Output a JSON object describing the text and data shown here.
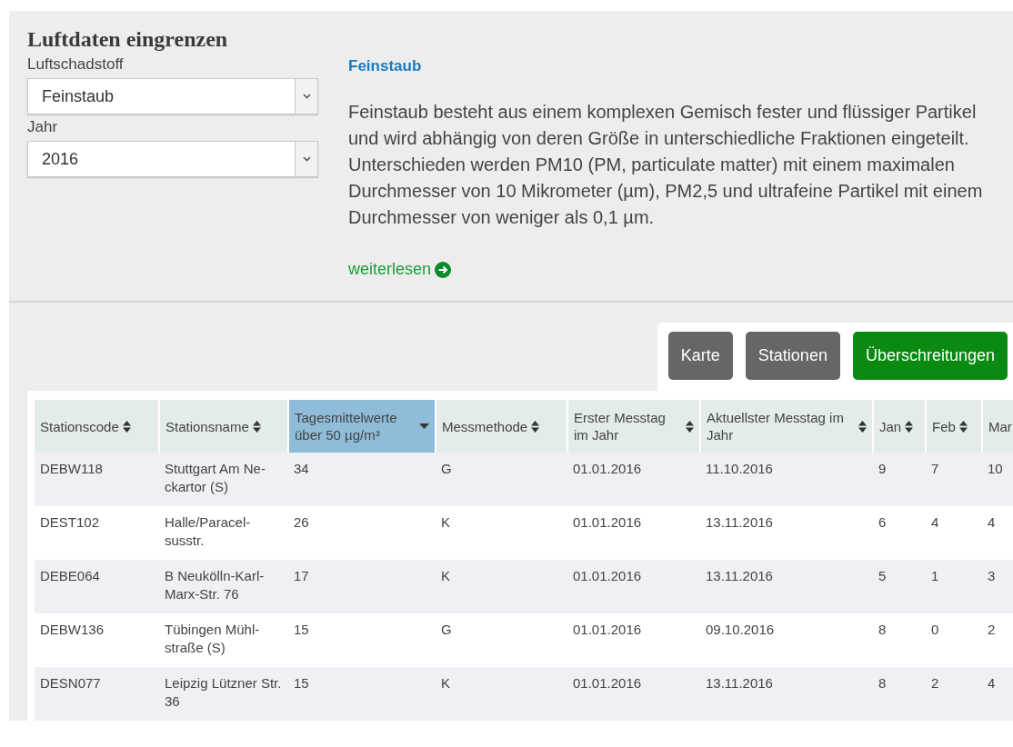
{
  "panel": {
    "title": "Luftdaten eingrenzen",
    "filters": [
      {
        "label": "Luftschadstoff",
        "value": "Feinstaub"
      },
      {
        "label": "Jahr",
        "value": "2016"
      }
    ],
    "info": {
      "heading": "Feinstaub",
      "text": "Feinstaub besteht aus einem komplexen Gemisch fester und flüssiger Partikel und wird abhängig von deren Größe in unterschiedliche Fraktionen eingeteilt. Unterschieden werden PM10 (PM, particulate matter) mit einem maximalen Durchmesser von 10 Mikrometer (µm), PM2,5 und ultrafeine Partikel mit einem Durchmesser von weniger als 0,1 µm.",
      "link": "weiterlesen"
    }
  },
  "view_buttons": [
    {
      "label": "Karte",
      "selected": false
    },
    {
      "label": "Stationen",
      "selected": false
    },
    {
      "label": "Überschreitungen",
      "selected": true
    }
  ],
  "table": {
    "columns": [
      {
        "label": "Stationscode",
        "selected": false
      },
      {
        "label": "Stationsname",
        "selected": false
      },
      {
        "label": "Tagesmittelwerte über 50 µg/m³",
        "selected": true
      },
      {
        "label": "Messmethode",
        "selected": false
      },
      {
        "label": "Erster Messtag im Jahr",
        "selected": false
      },
      {
        "label": "Aktuellster Messtag im Jahr",
        "selected": false
      },
      {
        "label": "Jan",
        "selected": false
      },
      {
        "label": "Feb",
        "selected": false
      },
      {
        "label": "Mar"
      }
    ],
    "rows": [
      [
        "DEBW118",
        "Stuttgart Am Ne-ckartor (S)",
        "34",
        "G",
        "01.01.2016",
        "11.10.2016",
        "9",
        "7",
        "10"
      ],
      [
        "DEST102",
        "Halle/Paracel-susstr.",
        "26",
        "K",
        "01.01.2016",
        "13.11.2016",
        "6",
        "4",
        "4"
      ],
      [
        "DEBE064",
        "B Neukölln-Karl-Marx-Str. 76",
        "17",
        "K",
        "01.01.2016",
        "13.11.2016",
        "5",
        "1",
        "3"
      ],
      [
        "DEBW136",
        "Tübingen Mühl-straße (S)",
        "15",
        "G",
        "01.01.2016",
        "09.10.2016",
        "8",
        "0",
        "2"
      ],
      [
        "DESN077",
        "Leipzig Lützner Str. 36",
        "15",
        "K",
        "01.01.2016",
        "13.11.2016",
        "8",
        "2",
        "4"
      ]
    ]
  }
}
